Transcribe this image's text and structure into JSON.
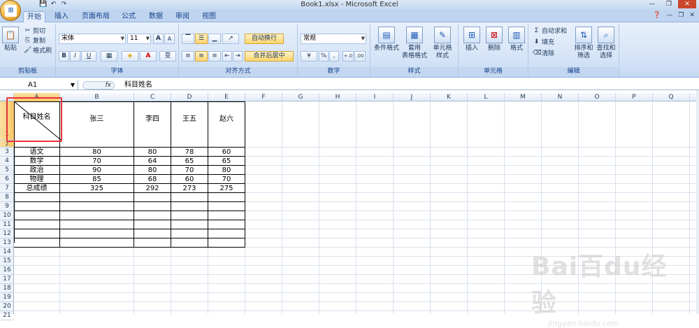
{
  "window": {
    "title": "Book1.xlsx - Microsoft Excel"
  },
  "qat": {
    "save": "💾",
    "undo": "↶",
    "redo": "↷"
  },
  "tabs": [
    {
      "label": "开始",
      "active": true
    },
    {
      "label": "插入"
    },
    {
      "label": "页面布局"
    },
    {
      "label": "公式"
    },
    {
      "label": "数据"
    },
    {
      "label": "审阅"
    },
    {
      "label": "视图"
    }
  ],
  "ribbon": {
    "clipboard": {
      "paste": "粘贴",
      "cut": "剪切",
      "copy": "复制",
      "format_painter": "格式刷",
      "group": "剪贴板"
    },
    "font": {
      "name": "宋体",
      "size": "11",
      "group": "字体",
      "bold": "B",
      "italic": "I",
      "underline": "U",
      "grow": "A",
      "shrink": "A",
      "phonetic": "变"
    },
    "alignment": {
      "wrap": "自动换行",
      "merge": "合并后居中",
      "group": "对齐方式"
    },
    "number": {
      "format": "常规",
      "percent": "%",
      "comma": ",",
      "inc": "+.0",
      "dec": ".00",
      "group": "数字"
    },
    "styles": {
      "conditional": "条件格式",
      "table_line1": "套用",
      "table_line2": "表格格式",
      "cell_line1": "单元格",
      "cell_line2": "样式",
      "group": "样式"
    },
    "cells": {
      "insert": "插入",
      "delete": "删除",
      "format": "格式",
      "group": "单元格"
    },
    "editing": {
      "autosum": "自动求和",
      "fill": "填充",
      "clear": "清除",
      "sort_line1": "排序和",
      "sort_line2": "筛选",
      "find_line1": "查找和",
      "find_line2": "选择",
      "group": "编辑"
    }
  },
  "formula_bar": {
    "name_box": "A1",
    "fx": "fx",
    "content": "科目姓名"
  },
  "columns": [
    "A",
    "B",
    "C",
    "D",
    "E",
    "F",
    "G",
    "H",
    "I",
    "J",
    "K",
    "L",
    "M",
    "N",
    "O",
    "P",
    "Q"
  ],
  "rows": [
    "1",
    "2",
    "3",
    "4",
    "5",
    "6",
    "7",
    "8",
    "9",
    "10",
    "11",
    "12",
    "13",
    "14",
    "15",
    "16",
    "17",
    "18",
    "19",
    "20",
    "21"
  ],
  "table": {
    "header_cell": "科目姓名",
    "names": [
      "张三",
      "李四",
      "王五",
      "赵六"
    ],
    "rows": [
      {
        "subject": "语文",
        "values": [
          "80",
          "80",
          "78",
          "60"
        ]
      },
      {
        "subject": "数学",
        "values": [
          "70",
          "64",
          "65",
          "65"
        ]
      },
      {
        "subject": "政治",
        "values": [
          "90",
          "80",
          "70",
          "80"
        ]
      },
      {
        "subject": "物理",
        "values": [
          "85",
          "68",
          "60",
          "70"
        ]
      },
      {
        "subject": "总成绩",
        "values": [
          "325",
          "292",
          "273",
          "275"
        ]
      }
    ]
  },
  "watermark": {
    "logo": "Bai百du经验",
    "url": "jingyan.baidu.com"
  }
}
